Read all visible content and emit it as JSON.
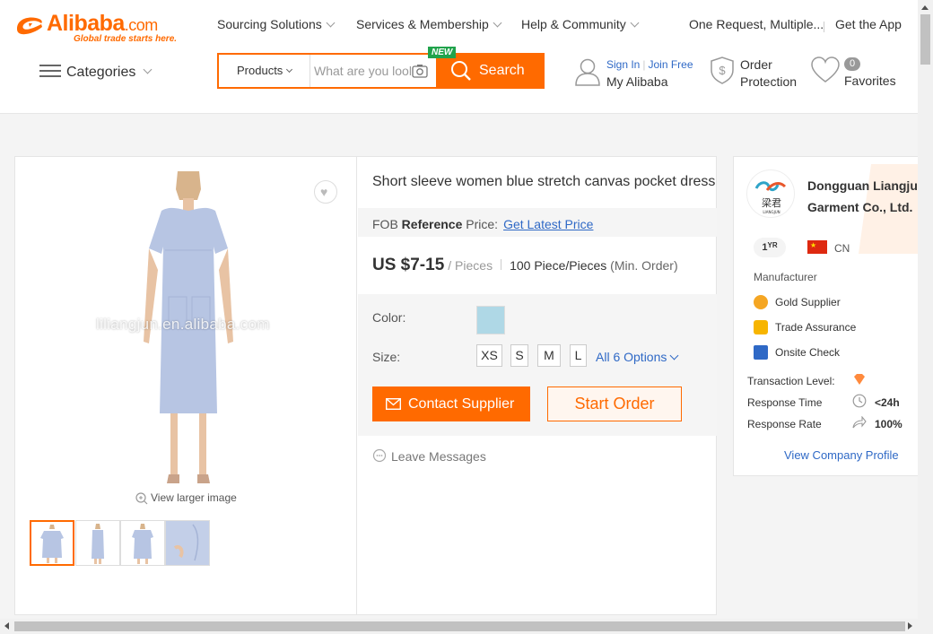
{
  "header": {
    "logo_name": "Alibaba",
    "logo_suffix": ".com",
    "logo_tagline": "Global trade starts here.",
    "nav": [
      "Sourcing Solutions",
      "Services & Membership",
      "Help & Community"
    ],
    "one_request": "One Request, Multiple...",
    "get_app": "Get the App",
    "categories_label": "Categories",
    "search": {
      "scope": "Products",
      "placeholder": "What are you looking for",
      "button": "Search",
      "new_badge": "NEW"
    },
    "user": {
      "sign_in": "Sign In",
      "join": "Join Free",
      "my": "My Alibaba"
    },
    "order_protection": {
      "line1": "Order",
      "line2": "Protection"
    },
    "favorites": {
      "count": "0",
      "label": "Favorites"
    }
  },
  "product": {
    "title": "Short sleeve women blue stretch canvas pocket dress",
    "fob_prefix": "FOB",
    "fob_bold": "Reference",
    "fob_suffix": "Price:",
    "fob_link": "Get Latest Price",
    "price": "US $7-15",
    "price_unit": "/ Pieces",
    "min_order_qty": "100 Piece/Pieces",
    "min_order_label": "(Min. Order)",
    "color_label": "Color:",
    "size_label": "Size:",
    "sizes": [
      "XS",
      "S",
      "M",
      "L"
    ],
    "all_options": "All 6 Options",
    "contact_button": "Contact Supplier",
    "start_order_button": "Start Order",
    "leave_messages": "Leave Messages",
    "view_larger": "View larger image",
    "watermark": "liliangjun.en.alibaba.com",
    "swatch_color": "#afd8e6"
  },
  "supplier": {
    "name_line1": "Dongguan Liangjun",
    "name_line2": "Garment Co., Ltd.",
    "years": "1",
    "years_suffix": "YR",
    "country": "CN",
    "type": "Manufacturer",
    "badges": [
      "Gold Supplier",
      "Trade Assurance",
      "Onsite Check"
    ],
    "transaction_level_label": "Transaction Level:",
    "response_time_label": "Response Time",
    "response_time_value": "<24h",
    "response_rate_label": "Response Rate",
    "response_rate_value": "100%",
    "profile_link": "View Company Profile"
  },
  "colors": {
    "accent": "#ff6a00",
    "link": "#2f69c6"
  }
}
